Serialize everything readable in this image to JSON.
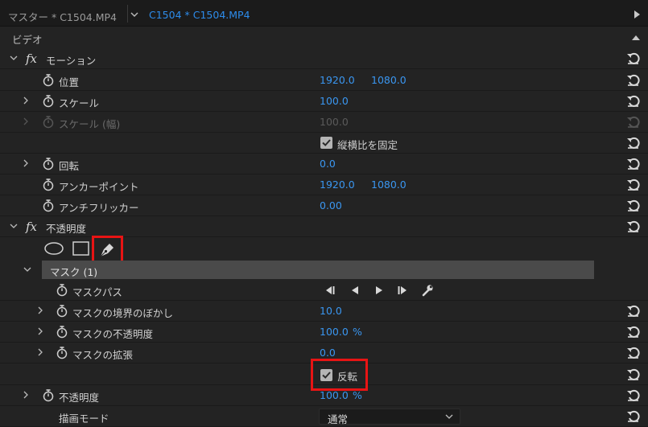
{
  "tabs": {
    "master": "マスター * C1504.MP4",
    "active": "C1504 * C1504.MP4"
  },
  "section": {
    "title": "ビデオ"
  },
  "motion": {
    "title": "モーション",
    "position": {
      "label": "位置",
      "x": "1920.0",
      "y": "1080.0"
    },
    "scale": {
      "label": "スケール",
      "value": "100.0"
    },
    "scale_width": {
      "label": "スケール (幅)",
      "value": "100.0"
    },
    "uniform_scale": {
      "label": "縦横比を固定",
      "checked": true
    },
    "rotation": {
      "label": "回転",
      "value": "0.0"
    },
    "anchor": {
      "label": "アンカーポイント",
      "x": "1920.0",
      "y": "1080.0"
    },
    "antiflicker": {
      "label": "アンチフリッカー",
      "value": "0.00"
    }
  },
  "opacity": {
    "title": "不透明度",
    "tools": [
      "ellipse-mask-tool",
      "rectangle-mask-tool",
      "pen-mask-tool"
    ],
    "mask": {
      "title": "マスク (1)",
      "path": {
        "label": "マスクパス"
      },
      "feather": {
        "label": "マスクの境界のぼかし",
        "value": "10.0"
      },
      "opacity": {
        "label": "マスクの不透明度",
        "value": "100.0",
        "unit": "%"
      },
      "expansion": {
        "label": "マスクの拡張",
        "value": "0.0"
      },
      "inverted": {
        "label": "反転",
        "checked": true
      }
    },
    "opacity_value": {
      "label": "不透明度",
      "value": "100.0",
      "unit": "%"
    },
    "blend_mode": {
      "label": "描画モード",
      "value": "通常"
    }
  },
  "colors": {
    "value_blue": "#3a96f0",
    "highlight_red": "#e81414",
    "background": "#232323"
  }
}
